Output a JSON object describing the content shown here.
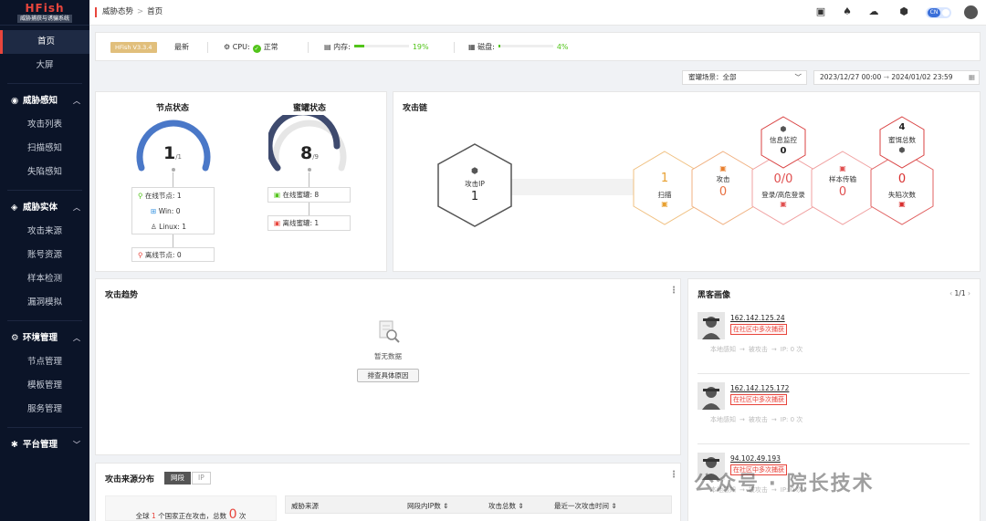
{
  "sidebar": {
    "brand": "HFish",
    "brand_sub": "威胁捕获与诱骗系统",
    "top_items": [
      {
        "label": "首页"
      },
      {
        "label": "大屏"
      }
    ],
    "groups": [
      {
        "label": "威胁感知",
        "items": [
          "攻击列表",
          "扫描感知",
          "失陷感知"
        ]
      },
      {
        "label": "威胁实体",
        "items": [
          "攻击来源",
          "账号资源",
          "样本检测",
          "漏洞模拟"
        ]
      },
      {
        "label": "环境管理",
        "items": [
          "节点管理",
          "模板管理",
          "服务管理"
        ]
      },
      {
        "label": "平台管理",
        "items": []
      }
    ]
  },
  "topbar": {
    "breadcrumb_root": "威胁态势",
    "breadcrumb_sep": ">",
    "breadcrumb_current": "首页",
    "lang": "CN"
  },
  "status": {
    "version": "HFish V3.3.4",
    "latest": "最新",
    "cpu_label": "CPU:",
    "cpu_status": "正常",
    "mem_label": "内存:",
    "mem_pct": "19%",
    "mem_value": 0.19,
    "disk_label": "磁盘:",
    "disk_pct": "4%",
    "disk_value": 0.04
  },
  "filters": {
    "scene_label": "蜜罐场景：",
    "scene_value": "全部",
    "date_start": "2023/12/27 00:00",
    "date_arrow": "→",
    "date_end": "2024/01/02 23:59"
  },
  "node_status": {
    "title": "节点状态",
    "value": "1",
    "total": "/1",
    "online_label": "在线节点:",
    "online": "1",
    "win_label": "Win:",
    "win": "0",
    "linux_label": "Linux:",
    "linux": "1",
    "offline_label": "离线节点:",
    "offline": "0"
  },
  "honeypot_status": {
    "title": "蜜罐状态",
    "value": "8",
    "total": "/9",
    "online_label": "在线蜜罐:",
    "online": "8",
    "offline_label": "离线蜜罐:",
    "offline": "1"
  },
  "attack_chain": {
    "title": "攻击链",
    "source_label": "攻击IP",
    "source_value": "1",
    "stages": [
      {
        "label": "扫描",
        "value": "1"
      },
      {
        "label": "攻击",
        "value": "0"
      },
      {
        "label": "登录/高危登录",
        "value": "0/0"
      },
      {
        "label": "样本传输",
        "value": "0"
      },
      {
        "label": "失陷次数",
        "value": "0"
      }
    ],
    "info_monitor_label": "信息监控",
    "info_monitor_value": "0",
    "bait_label": "蜜饵总数",
    "bait_value": "4"
  },
  "attack_trend": {
    "title": "攻击趋势",
    "empty_text": "暂无数据",
    "button": "排查具体原因"
  },
  "attack_source": {
    "title": "攻击来源分布",
    "tabs": [
      "网段",
      "IP"
    ],
    "summary_prefix": "全球",
    "country_count": "1",
    "summary_mid": "个国家正在攻击，总数",
    "total": "0",
    "summary_suffix": "次",
    "columns": [
      "威胁来源",
      "网段内IP数 ⇕",
      "攻击总数 ⇕",
      "最近一次攻击时间 ⇕"
    ]
  },
  "hacker_profile": {
    "title": "黑客画像",
    "pager": "1/1",
    "items": [
      {
        "ip": "162.142.125.24",
        "tag": "在社区中多次捕获",
        "flow": [
          "本地感知",
          "被攻击",
          "IP: 0 次"
        ]
      },
      {
        "ip": "162.142.125.172",
        "tag": "在社区中多次捕获",
        "flow": [
          "本地感知",
          "被攻击",
          "IP: 0 次"
        ]
      },
      {
        "ip": "94.102.49.193",
        "tag": "在社区中多次捕获",
        "flow": [
          "本地感知",
          "被攻击",
          "IP: 0 次"
        ]
      }
    ]
  },
  "watermark": "公众号 · 院长技术"
}
